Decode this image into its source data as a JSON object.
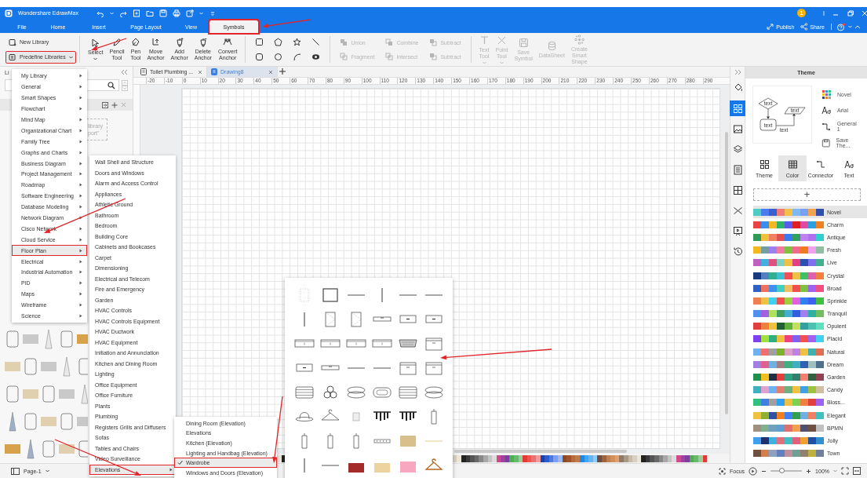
{
  "title_bar": {
    "app_title": "Wondershare EdrawMax",
    "notification_badge": "1"
  },
  "menu_tabs": [
    {
      "label": "File",
      "selected": false,
      "annotated": false
    },
    {
      "label": "Home",
      "selected": false,
      "annotated": false
    },
    {
      "label": "Insert",
      "selected": false,
      "annotated": false
    },
    {
      "label": "Page Layout",
      "selected": false,
      "annotated": false
    },
    {
      "label": "View",
      "selected": false,
      "annotated": false
    },
    {
      "label": "Symbols",
      "selected": true,
      "annotated": true
    }
  ],
  "header_actions": [
    {
      "label": "Publish"
    },
    {
      "label": "Share"
    }
  ],
  "ribbon": {
    "library_buttons": [
      {
        "label": "New Library",
        "has_menu": false,
        "annotated": false
      },
      {
        "label": "Predefine Libraries",
        "has_menu": true,
        "annotated": true
      }
    ],
    "tools": [
      {
        "label": "Select",
        "has_menu": true
      },
      {
        "label": "Pencil Tool",
        "has_menu": false
      },
      {
        "label": "Pen Tool",
        "has_menu": false
      },
      {
        "label": "Move Anchor",
        "has_menu": false
      },
      {
        "label": "Add Anchor",
        "has_menu": false
      },
      {
        "label": "Delete Anchor",
        "has_menu": false
      },
      {
        "label": "Convert Anchor",
        "has_menu": false
      }
    ],
    "boolean_ops": [
      {
        "label": "Union",
        "disabled": true
      },
      {
        "label": "Combine",
        "disabled": true
      },
      {
        "label": "Subtract",
        "disabled": true
      },
      {
        "label": "Fragment",
        "disabled": true
      },
      {
        "label": "Intersect",
        "disabled": true
      },
      {
        "label": "Subtract",
        "disabled": true
      }
    ],
    "symbol_tools": [
      {
        "label": "Text Tool",
        "has_menu": true,
        "disabled": true
      },
      {
        "label": "Point Tool",
        "has_menu": true,
        "disabled": true
      },
      {
        "label": "Save Symbol",
        "has_menu": false,
        "disabled": true
      },
      {
        "label": "DataSheet",
        "has_menu": false,
        "disabled": true
      },
      {
        "label": "Create Smart Shape",
        "has_menu": false,
        "disabled": true
      }
    ]
  },
  "left_panel": {
    "heading": "Li",
    "hint_lines": [
      "library",
      "port\""
    ]
  },
  "document_tabs": [
    {
      "label": "Toilet Plumbing ...",
      "selected": false
    },
    {
      "label": "Drawing8",
      "selected": true
    }
  ],
  "ruler": [
    "-20",
    "-10",
    "0",
    "10",
    "20",
    "30",
    "40",
    "50",
    "60",
    "70",
    "80",
    "90",
    "100",
    "110",
    "120",
    "130",
    "140",
    "150",
    "160",
    "170",
    "180",
    "190",
    "200",
    "210",
    "220",
    "230",
    "240",
    "250",
    "260",
    "270",
    "280",
    "290"
  ],
  "side_tools": [
    {
      "selected": false
    },
    {
      "selected": true
    },
    {
      "selected": false
    },
    {
      "selected": false
    },
    {
      "selected": false
    },
    {
      "selected": false
    },
    {
      "selected": false
    },
    {
      "selected": false
    },
    {
      "selected": false
    }
  ],
  "theme_panel": {
    "title": "Theme",
    "preview_labels": [
      "text",
      "text",
      "text",
      "text"
    ],
    "options": [
      "Novel",
      "Arial",
      "General 1",
      "Save The..."
    ],
    "tabs": [
      {
        "label": "Theme",
        "selected": false
      },
      {
        "label": "Color",
        "selected": true
      },
      {
        "label": "Connector",
        "selected": false
      },
      {
        "label": "Text",
        "selected": false
      }
    ],
    "add_label": "+",
    "schemes": [
      {
        "name": "Novel",
        "selected": true
      },
      {
        "name": "Charm",
        "selected": false
      },
      {
        "name": "Antique",
        "selected": false
      },
      {
        "name": "Fresh",
        "selected": false
      },
      {
        "name": "Live",
        "selected": false
      },
      {
        "name": "Crystal",
        "selected": false
      },
      {
        "name": "Broad",
        "selected": false
      },
      {
        "name": "Sprinkle",
        "selected": false
      },
      {
        "name": "Tranquil",
        "selected": false
      },
      {
        "name": "Opulent",
        "selected": false
      },
      {
        "name": "Placid",
        "selected": false
      },
      {
        "name": "Natural",
        "selected": false
      },
      {
        "name": "Dream",
        "selected": false
      },
      {
        "name": "Garden",
        "selected": false
      },
      {
        "name": "Candy",
        "selected": false
      },
      {
        "name": "Bloss...",
        "selected": false
      },
      {
        "name": "Elegant",
        "selected": false
      },
      {
        "name": "BPMN",
        "selected": false
      },
      {
        "name": "Jolly",
        "selected": false
      },
      {
        "name": "Town",
        "selected": false
      }
    ]
  },
  "status_bar": {
    "page": "Page-1",
    "focus": "Focus",
    "zoom": "100%",
    "zoom_slider": {
      "level": 0.35
    }
  },
  "menus": {
    "libraries": [
      {
        "label": "My Library",
        "selected": false,
        "annotated": false
      },
      {
        "label": "General",
        "selected": false,
        "annotated": false
      },
      {
        "label": "Smart Shapes",
        "selected": false,
        "annotated": false
      },
      {
        "label": "Flowchart",
        "selected": false,
        "annotated": false
      },
      {
        "label": "Mind Map",
        "selected": false,
        "annotated": false
      },
      {
        "label": "Organizational Chart",
        "selected": false,
        "annotated": false
      },
      {
        "label": "Family Tree",
        "selected": false,
        "annotated": false
      },
      {
        "label": "Graphs and Charts",
        "selected": false,
        "annotated": false
      },
      {
        "label": "Business Diagram",
        "selected": false,
        "annotated": false
      },
      {
        "label": "Project Management",
        "selected": false,
        "annotated": false
      },
      {
        "label": "Roadmap",
        "selected": false,
        "annotated": false
      },
      {
        "label": "Software Engineering",
        "selected": false,
        "annotated": false
      },
      {
        "label": "Database Modeling",
        "selected": false,
        "annotated": false
      },
      {
        "label": "Network Diagram",
        "selected": false,
        "annotated": false
      },
      {
        "label": "Cisco Network",
        "selected": false,
        "annotated": false
      },
      {
        "label": "Cloud Service",
        "selected": false,
        "annotated": false
      },
      {
        "label": "Floor Plan",
        "selected": true,
        "annotated": true
      },
      {
        "label": "Electrical",
        "selected": false,
        "annotated": false
      },
      {
        "label": "Industrial Automation",
        "selected": false,
        "annotated": false
      },
      {
        "label": "PID",
        "selected": false,
        "annotated": false
      },
      {
        "label": "Maps",
        "selected": false,
        "annotated": false
      },
      {
        "label": "Wireframe",
        "selected": false,
        "annotated": false
      },
      {
        "label": "Science",
        "selected": false,
        "annotated": false
      }
    ],
    "floor_plan": [
      {
        "label": "Wall Shell and Structure",
        "has_submenu": false,
        "selected": false,
        "annotated": false
      },
      {
        "label": "Doors and Windows",
        "has_submenu": false,
        "selected": false,
        "annotated": false
      },
      {
        "label": "Alarm and Access Control",
        "has_submenu": false,
        "selected": false,
        "annotated": false
      },
      {
        "label": "Appliances",
        "has_submenu": false,
        "selected": false,
        "annotated": false
      },
      {
        "label": "Athletic Ground",
        "has_submenu": false,
        "selected": false,
        "annotated": false
      },
      {
        "label": "Bathroom",
        "has_submenu": false,
        "selected": false,
        "annotated": false
      },
      {
        "label": "Bedroom",
        "has_submenu": false,
        "selected": false,
        "annotated": false
      },
      {
        "label": "Building Core",
        "has_submenu": false,
        "selected": false,
        "annotated": false
      },
      {
        "label": "Cabinets and Bookcases",
        "has_submenu": false,
        "selected": false,
        "annotated": false
      },
      {
        "label": "Carpet",
        "has_submenu": false,
        "selected": false,
        "annotated": false
      },
      {
        "label": "Dimensioning",
        "has_submenu": false,
        "selected": false,
        "annotated": false
      },
      {
        "label": "Electrical and Telecom",
        "has_submenu": false,
        "selected": false,
        "annotated": false
      },
      {
        "label": "Fire and Emergency",
        "has_submenu": false,
        "selected": false,
        "annotated": false
      },
      {
        "label": "Garden",
        "has_submenu": false,
        "selected": false,
        "annotated": false
      },
      {
        "label": "HVAC Controls",
        "has_submenu": false,
        "selected": false,
        "annotated": false
      },
      {
        "label": "HVAC Controls Equipment",
        "has_submenu": false,
        "selected": false,
        "annotated": false
      },
      {
        "label": "HVAC Ductwork",
        "has_submenu": false,
        "selected": false,
        "annotated": false
      },
      {
        "label": "HVAC Equipment",
        "has_submenu": false,
        "selected": false,
        "annotated": false
      },
      {
        "label": "Initiation and Annunciation",
        "has_submenu": false,
        "selected": false,
        "annotated": false
      },
      {
        "label": "Kitchen and Dining Room",
        "has_submenu": false,
        "selected": false,
        "annotated": false
      },
      {
        "label": "Lighting",
        "has_submenu": false,
        "selected": false,
        "annotated": false
      },
      {
        "label": "Office Equipment",
        "has_submenu": false,
        "selected": false,
        "annotated": false
      },
      {
        "label": "Office Furniture",
        "has_submenu": false,
        "selected": false,
        "annotated": false
      },
      {
        "label": "Plants",
        "has_submenu": false,
        "selected": false,
        "annotated": false
      },
      {
        "label": "Plumbing",
        "has_submenu": false,
        "selected": false,
        "annotated": false
      },
      {
        "label": "Registers Grills and Diffusers",
        "has_submenu": false,
        "selected": false,
        "annotated": false
      },
      {
        "label": "Sofas",
        "has_submenu": false,
        "selected": false,
        "annotated": false
      },
      {
        "label": "Tables and Chairs",
        "has_submenu": false,
        "selected": false,
        "annotated": false
      },
      {
        "label": "Video Surveillance",
        "has_submenu": false,
        "selected": false,
        "annotated": false
      },
      {
        "label": "Elevations",
        "has_submenu": true,
        "selected": true,
        "annotated": true
      }
    ],
    "elevations": [
      {
        "label": "Dining Room (Elevation)",
        "checked": false,
        "annotated": false
      },
      {
        "label": "Elevations",
        "checked": false,
        "annotated": false
      },
      {
        "label": "Kitchen (Elevation)",
        "checked": false,
        "annotated": false
      },
      {
        "label": "Lighting and Handbag (Elevation)",
        "checked": false,
        "annotated": false
      },
      {
        "label": "Wardrobe",
        "checked": true,
        "annotated": true
      },
      {
        "label": "Windows and Doors (Elevation)",
        "checked": false,
        "annotated": false
      }
    ]
  }
}
